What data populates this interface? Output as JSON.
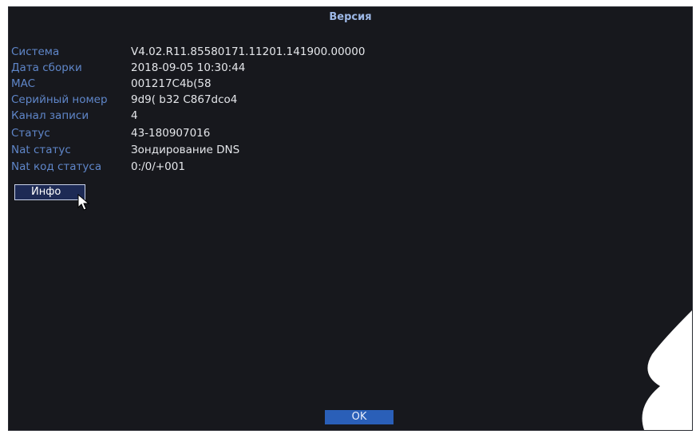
{
  "window": {
    "title": "Версия"
  },
  "info": {
    "rows": [
      {
        "label": "Система",
        "value": "V4.02.R11.85580171.11201.141900.00000"
      },
      {
        "label": "Дата сборки",
        "value": "2018-09-05 10:30:44"
      },
      {
        "label": "MAC",
        "value": "001217C4b(58"
      },
      {
        "label": "Серийный номер",
        "value": "9d9( b32 C867dco4"
      },
      {
        "label": "Канал записи",
        "value": "4"
      },
      {
        "label": "Статус",
        "value": "43-180907016"
      },
      {
        "label": "Nat статус",
        "value": "Зондирование DNS"
      },
      {
        "label": "Nat код статуса",
        "value": "0:/0/+001"
      }
    ]
  },
  "buttons": {
    "info_label": "Инфо",
    "ok_label": "OK"
  },
  "colors": {
    "background": "#17181d",
    "label": "#5f86c9",
    "value": "#e4e6ea",
    "title": "#9db8e6",
    "ok_button": "#2a5fb8",
    "info_button": "#1d2a55"
  }
}
